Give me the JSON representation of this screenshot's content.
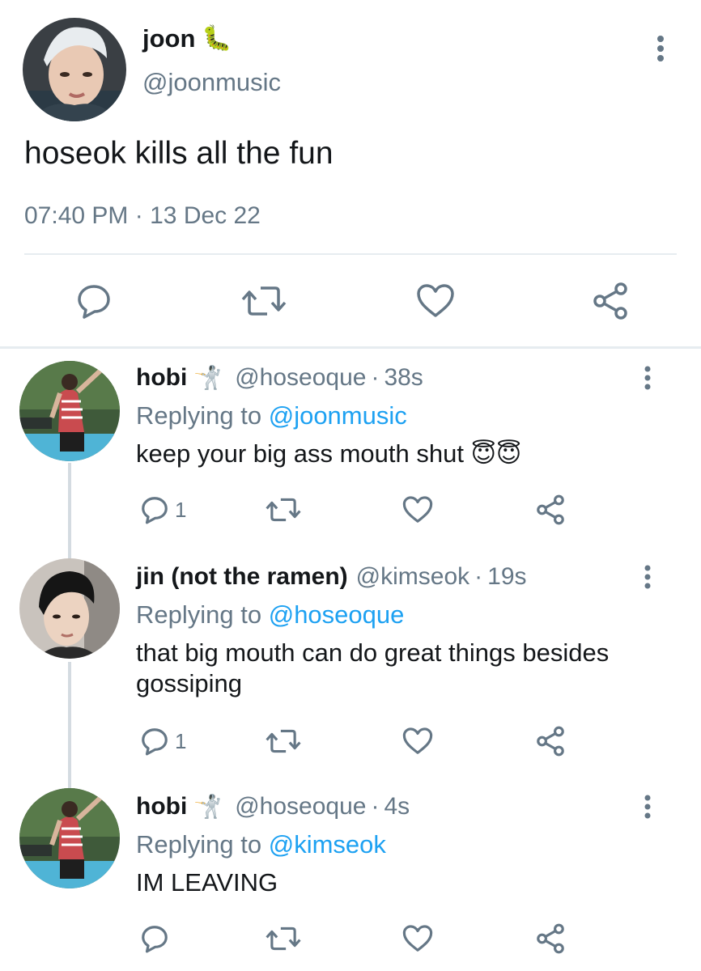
{
  "main_tweet": {
    "display_name": "joon",
    "name_emoji": "🐛",
    "handle": "@joonmusic",
    "text": "hoseok kills all the fun",
    "time": "07:40 PM",
    "separator": "·",
    "date": "13 Dec 22",
    "actions": [
      "reply-icon",
      "retweet-icon",
      "like-icon",
      "share-icon"
    ]
  },
  "replies": [
    {
      "display_name": "hobi",
      "name_emoji": "🤺",
      "handle": "@hoseoque",
      "separator": "·",
      "age": "38s",
      "replying_prefix": "Replying to",
      "replying_to": "@joonmusic",
      "text": "keep your big ass mouth shut",
      "text_emoji": "😇😇",
      "reply_count": "1"
    },
    {
      "display_name": "jin (not the ramen)",
      "name_emoji": "",
      "handle": "@kimseok",
      "separator": "·",
      "age": "19s",
      "replying_prefix": "Replying to",
      "replying_to": "@hoseoque",
      "text": "that big mouth can do great things besides gossiping",
      "text_emoji": "",
      "reply_count": "1"
    },
    {
      "display_name": "hobi",
      "name_emoji": "🤺",
      "handle": "@hoseoque",
      "separator": "·",
      "age": "4s",
      "replying_prefix": "Replying to",
      "replying_to": "@kimseok",
      "text": "IM LEAVING",
      "text_emoji": "",
      "reply_count": ""
    }
  ],
  "colors": {
    "text": "#14171a",
    "muted": "#657786",
    "link": "#1da1f2",
    "divider": "#e6ecf0",
    "thread_line": "#d4dbe1"
  }
}
